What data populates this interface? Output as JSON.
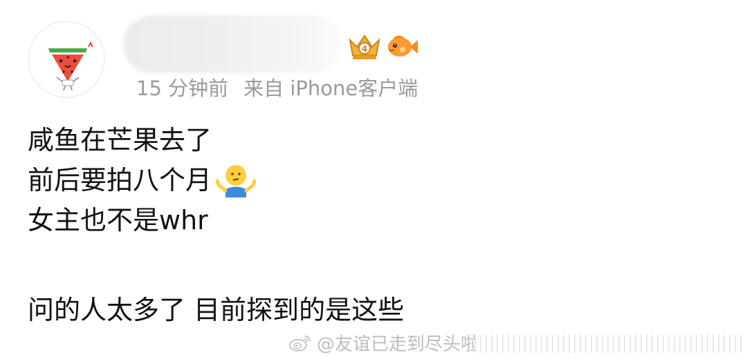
{
  "post": {
    "time": "15 分钟前",
    "source": "来自 iPhone客户端",
    "lines": [
      "咸鱼在芒果去了",
      "前后要拍八个月",
      "女主也不是whr",
      "问的人太多了 目前探到的是这些"
    ]
  },
  "watermark": {
    "text": "@友谊已走到尽头啦"
  },
  "icons": {
    "avatar": "watermelon-character-icon",
    "badge1": "crown-badge-icon",
    "badge2": "orange-fish-badge-icon",
    "emoji": "shrug-emoji-icon",
    "watermark": "weibo-icon"
  },
  "colors": {
    "meta_text": "#9a9a9a",
    "body_text": "#111111",
    "watermark_text": "#bdbdbd"
  }
}
